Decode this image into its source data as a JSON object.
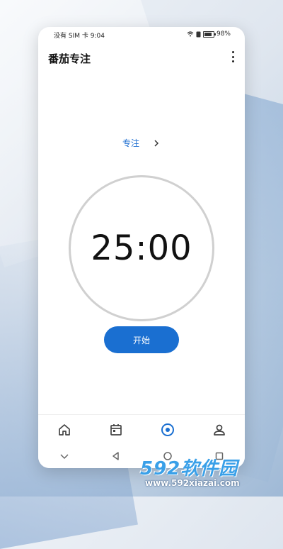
{
  "status_bar": {
    "carrier_time": "没有 SIM 卡 9:04",
    "battery": "98%"
  },
  "app": {
    "title": "番茄专注"
  },
  "mode": {
    "label": "专注"
  },
  "timer": {
    "value": "25:00"
  },
  "actions": {
    "start_label": "开始"
  },
  "nav": {
    "items": [
      "home-icon",
      "calendar-icon",
      "timer-icon",
      "profile-icon"
    ],
    "active_index": 2,
    "active_color": "#1a6fd1"
  },
  "watermark": {
    "text": "592软件园",
    "url": "www.592xiazai.com"
  }
}
